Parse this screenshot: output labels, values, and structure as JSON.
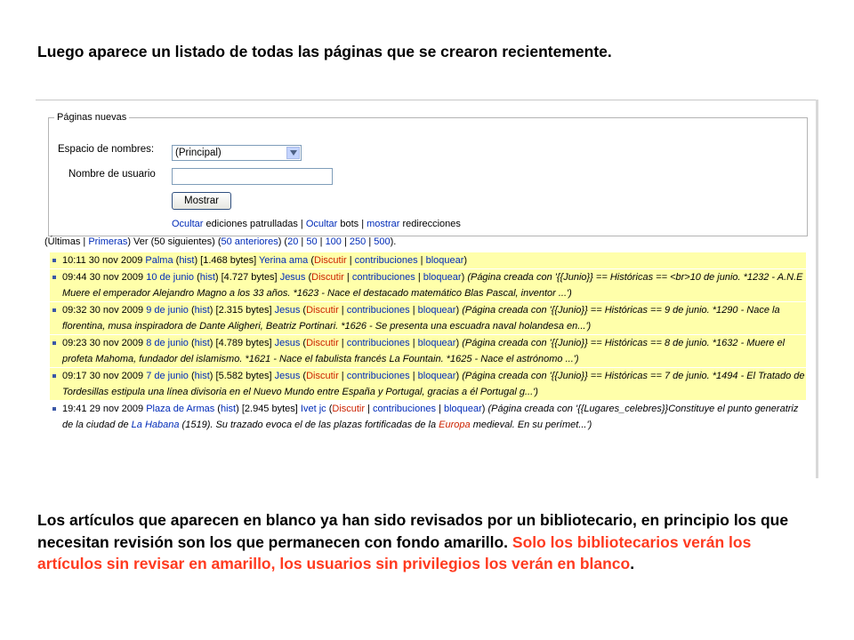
{
  "heading": "Luego aparece un listado de todas las páginas que se crearon recientemente.",
  "form": {
    "legend": "Páginas nuevas",
    "namespace_label": "Espacio de nombres:",
    "namespace_value": "(Principal)",
    "username_label": "Nombre de usuario",
    "username_value": "",
    "submit_label": "Mostrar",
    "options": {
      "ocultar1": "Ocultar",
      "text1": " ediciones patrulladas | ",
      "ocultar2": "Ocultar",
      "text2": " bots | ",
      "mostrar": "mostrar",
      "text3": " redirecciones"
    }
  },
  "nav": {
    "t1": "(Últimas | ",
    "primeras": "Primeras",
    "t2": ") Ver (50 siguientes) (",
    "anteriores": "50 anteriores",
    "t3": ") (",
    "n20": "20",
    "n50": "50",
    "n100": "100",
    "n250": "250",
    "n500": "500",
    "sep": " | ",
    "t4": ")."
  },
  "colors": {
    "unpatrolled_bg": "#ffffaa",
    "link": "#002bb8",
    "red_link": "#cc2200",
    "highlight_text": "#ff3a1f"
  },
  "entries": [
    {
      "time": "10:11 30 nov 2009",
      "title": "Palma",
      "hist": "hist",
      "size": "[1.468 bytes]",
      "user": "Yerina ama",
      "discutir": "Discutir",
      "contribuciones": "contribuciones",
      "bloquear": "bloquear",
      "comment": ""
    },
    {
      "time": "09:44 30 nov 2009",
      "title": "10 de junio",
      "hist": "hist",
      "size": "[4.727 bytes]",
      "user": "Jesus",
      "discutir": "Discutir",
      "contribuciones": "contribuciones",
      "bloquear": "bloquear",
      "comment": "(Página creada con '{{Junio}} == Históricas == <br>10 de junio. *1232 - A.N.E Muere el emperador Alejandro Magno a los 33 años. *1623 - Nace el destacado matemático Blas Pascal, inventor ...')"
    },
    {
      "time": "09:32 30 nov 2009",
      "title": "9 de junio",
      "hist": "hist",
      "size": "[2.315 bytes]",
      "user": "Jesus",
      "discutir": "Discutir",
      "contribuciones": "contribuciones",
      "bloquear": "bloquear",
      "comment": "(Página creada con '{{Junio}} == Históricas == 9 de junio. *1290 - Nace la florentina, musa inspiradora de Dante Aligheri, Beatriz Portinari. *1626 - Se presenta una escuadra naval holandesa en...')"
    },
    {
      "time": "09:23 30 nov 2009",
      "title": "8 de junio",
      "hist": "hist",
      "size": "[4.789 bytes]",
      "user": "Jesus",
      "discutir": "Discutir",
      "contribuciones": "contribuciones",
      "bloquear": "bloquear",
      "comment": "(Página creada con '{{Junio}} == Históricas == 8 de junio. *1632 - Muere el profeta Mahoma, fundador del islamismo. *1621 - Nace el fabulista francés La Fountain. *1625 - Nace el astrónomo ...')"
    },
    {
      "time": "09:17 30 nov 2009",
      "title": "7 de junio",
      "hist": "hist",
      "size": "[5.582 bytes]",
      "user": "Jesus",
      "discutir": "Discutir",
      "contribuciones": "contribuciones",
      "bloquear": "bloquear",
      "comment": "(Página creada con '{{Junio}} == Históricas == 7 de junio. *1494 - El Tratado de Tordesillas estipula una línea divisoria en el Nuevo Mundo entre España y Portugal, gracias a él Portugal g...')"
    }
  ],
  "last_entry": {
    "time": "19:41 29 nov 2009",
    "title": "Plaza de Armas",
    "hist": "hist",
    "size": "[2.945 bytes]",
    "user": "Ivet jc",
    "discutir": "Discutir",
    "contribuciones": "contribuciones",
    "bloquear": "bloquear",
    "comment_a": "(Página creada con '{{Lugares_celebres}}Constituye el punto generatriz de la ciudad de ",
    "habana": "La Habana",
    "comment_b": " (1519). Su trazado evoca el de las plazas fortificadas de la ",
    "europa": "Europa",
    "comment_c": " medieval. En su perímet...')"
  },
  "bottom": {
    "part1": "Los artículos que aparecen en blanco ya han sido revisados por un bibliotecario, en principio los que necesitan revisión son los que permanecen con fondo amarillo. ",
    "part2": "Solo los bibliotecarios verán los artículos sin revisar en amarillo, los usuarios sin privilegios los verán en blanco",
    "part3": "."
  }
}
